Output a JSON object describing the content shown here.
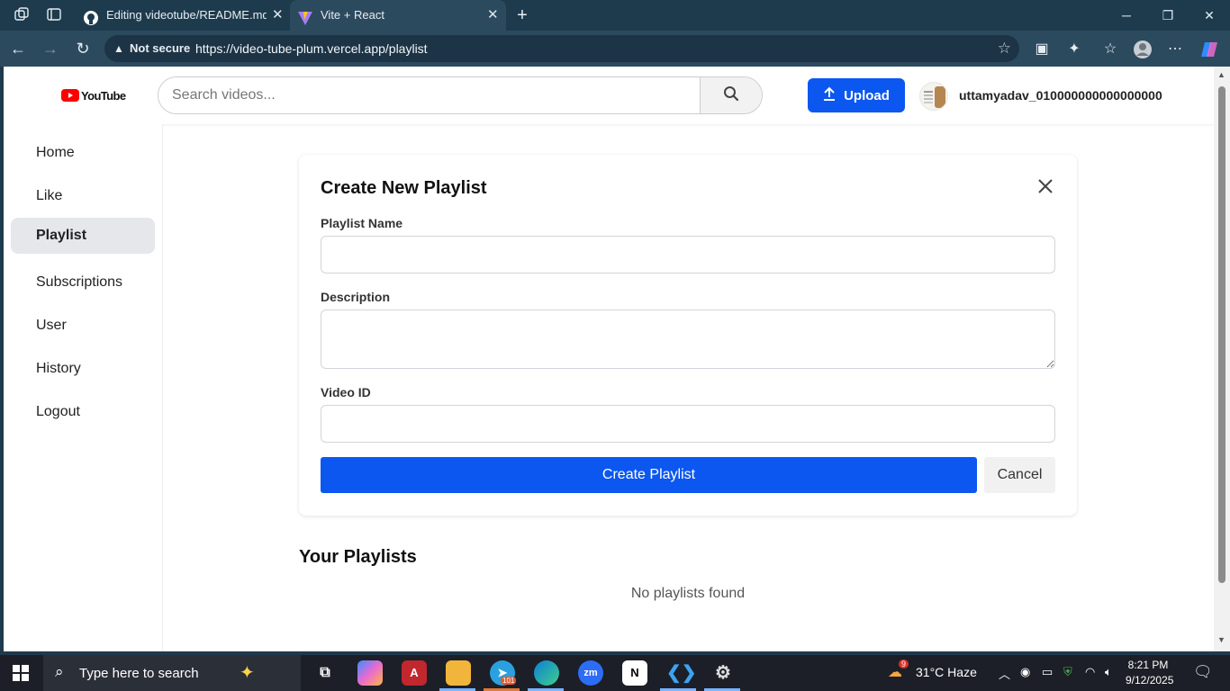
{
  "browser": {
    "tabs": [
      {
        "title": "Editing videotube/README.md at",
        "active": false
      },
      {
        "title": "Vite + React",
        "active": true
      }
    ],
    "security_label": "Not secure",
    "url": "https://video-tube-plum.vercel.app/playlist"
  },
  "header": {
    "logo_text": "YouTube",
    "search_placeholder": "Search videos...",
    "upload_label": "Upload",
    "username": "uttamyadav_010000000000000000"
  },
  "sidebar": {
    "items": [
      {
        "label": "Home"
      },
      {
        "label": "Like"
      },
      {
        "label": "Playlist",
        "active": true
      },
      {
        "label": "Subscriptions"
      },
      {
        "label": "User"
      },
      {
        "label": "History"
      },
      {
        "label": "Logout"
      }
    ]
  },
  "create_form": {
    "title": "Create New Playlist",
    "name_label": "Playlist Name",
    "name_value": "",
    "description_label": "Description",
    "description_value": "",
    "video_id_label": "Video ID",
    "video_id_value": "",
    "submit_label": "Create Playlist",
    "cancel_label": "Cancel"
  },
  "playlists": {
    "heading": "Your Playlists",
    "empty_text": "No playlists found"
  },
  "taskbar": {
    "search_placeholder": "Type here to search",
    "weather": "31°C  Haze",
    "weather_badge": "9",
    "telegram_badge": "101",
    "time": "8:21 PM",
    "date": "9/12/2025"
  },
  "colors": {
    "primary_blue": "#0b57f0",
    "active_sidebar": "#e5e7eb",
    "browser_frame": "#1e3b4e"
  }
}
